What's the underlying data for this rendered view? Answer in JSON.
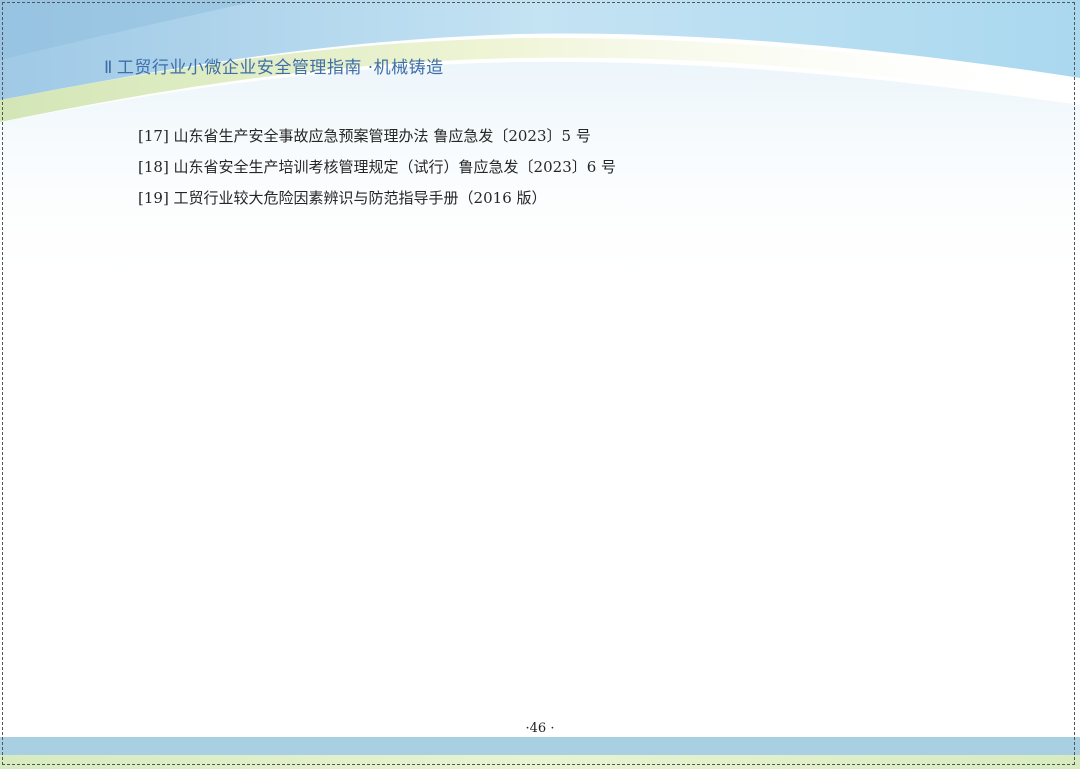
{
  "header": {
    "marker": "Ⅱ",
    "title": "工贸行业小微企业安全管理指南 ·机械铸造"
  },
  "references": [
    "[17] 山东省生产安全事故应急预案管理办法 鲁应急发〔2023〕5 号",
    "[18] 山东省安全生产培训考核管理规定（试行）鲁应急发〔2023〕6 号",
    "[19] 工贸行业较大危险因素辨识与防范指导手册（2016 版）"
  ],
  "footer": {
    "page_number": "·46 ·"
  },
  "colors": {
    "title_blue": "#3f6fa8",
    "sky_blue": "#b7ddef",
    "band_blue": "#a9cfe2",
    "band_green": "#d7ebc0"
  }
}
